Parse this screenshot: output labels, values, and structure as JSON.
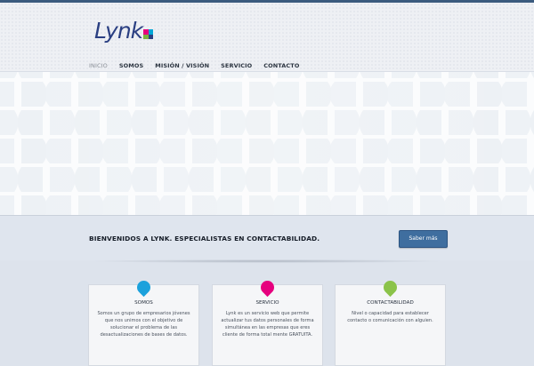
{
  "brand": {
    "logo_text": "Lynk",
    "logo_colors": [
      "#e6007e",
      "#00a6d6",
      "#7cb342",
      "#2a3f82"
    ]
  },
  "nav": {
    "items": [
      "INICIO",
      "SOMOS",
      "MISIÓN / VISIÓN",
      "SERVICIO",
      "CONTACTO"
    ],
    "active": "INICIO"
  },
  "welcome": {
    "text": "BIENVENIDOS A LYNK. ESPECIALISTAS EN CONTACTABILIDAD.",
    "button_label": "Saber más"
  },
  "cards": [
    {
      "title": "SOMOS",
      "body": "Somos un grupo de empresarios jóvenes que nos unimos con el objetivo de solucionar el problema de las desactualizaciones de bases de datos.",
      "color": "#1ba1dc",
      "icon": "speech-bubble-icon"
    },
    {
      "title": "SERVICIO",
      "body": "Lynk es un servicio web que permite actualizar tus datos personales de forma simultánea en las empresas que eres cliente de forma total mente GRATUITA.",
      "color": "#e6007e",
      "icon": "speech-bubble-icon"
    },
    {
      "title": "CONTACTABILIDAD",
      "body": "Nivel o capacidad para establecer contacto o comunicación con alguien.",
      "color": "#8bc34a",
      "icon": "speech-bubble-icon"
    }
  ],
  "colors": {
    "top_bar": "#3b5b7e",
    "button": "#3f6e9f",
    "nav_text": "#2b3440"
  }
}
